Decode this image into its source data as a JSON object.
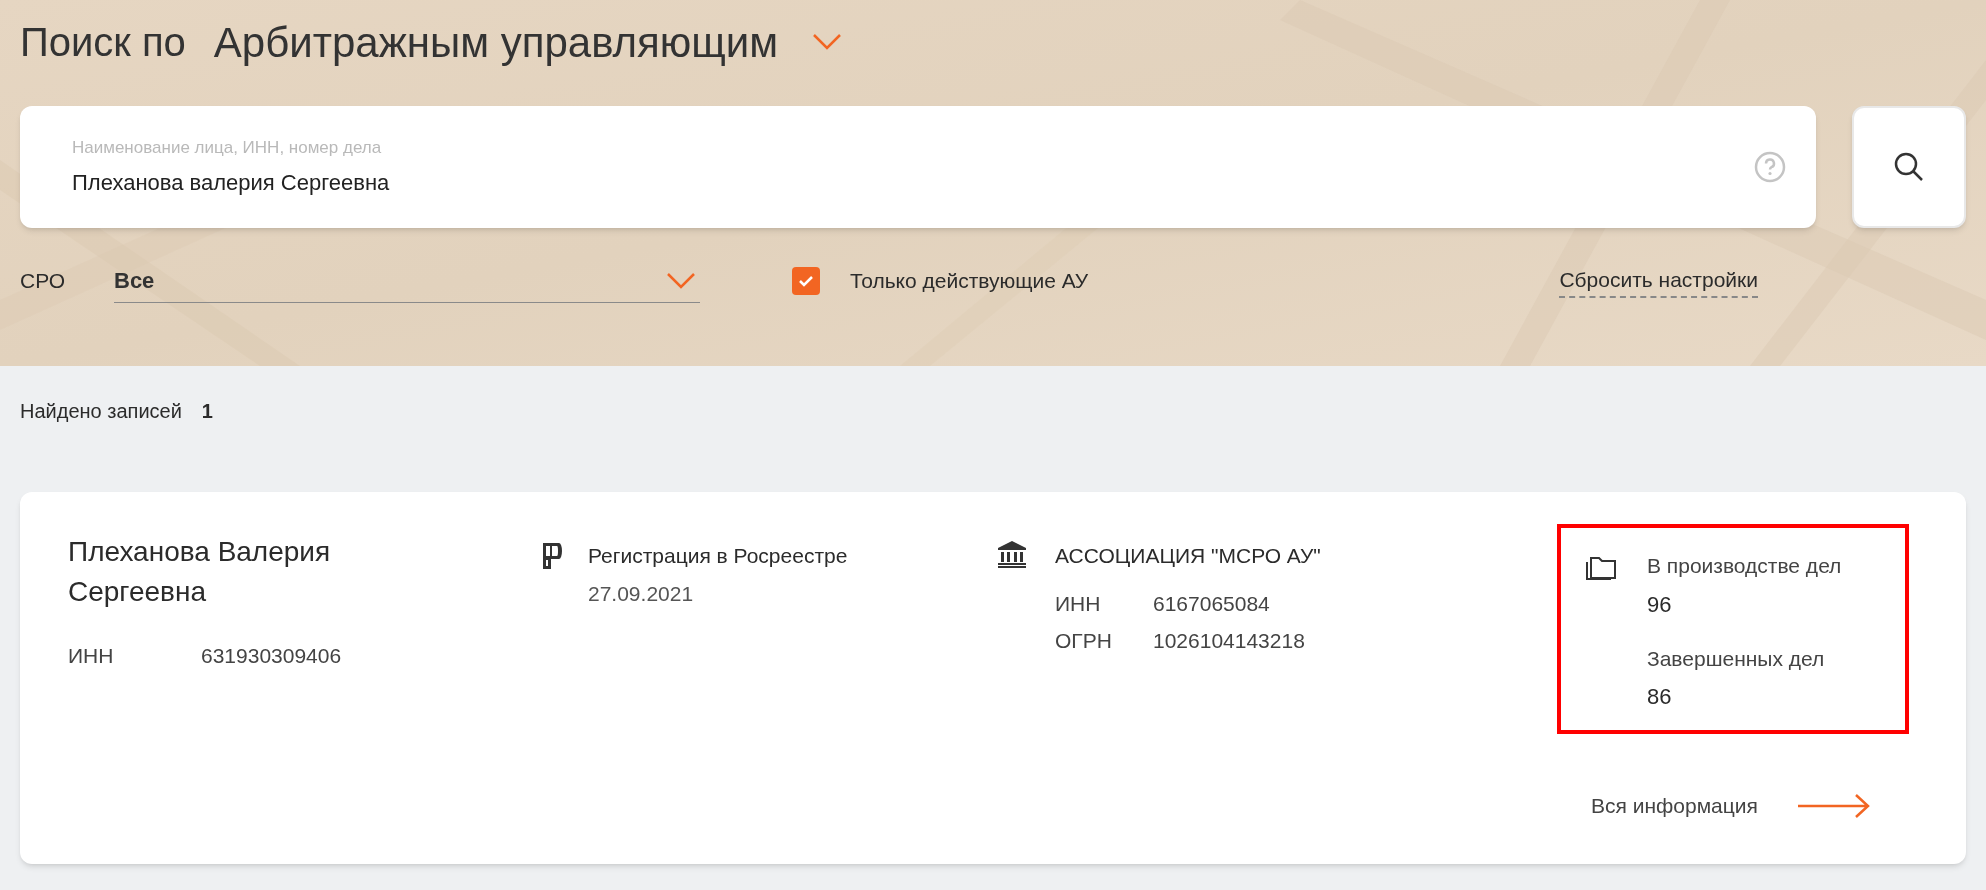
{
  "header": {
    "title_prefix": "Поиск по",
    "title_scope": "Арбитражным управляющим"
  },
  "search": {
    "placeholder": "Наименование лица, ИНН, номер дела",
    "value": "Плеханова валерия Сергеевна"
  },
  "filters": {
    "sro_label": "СРО",
    "sro_value": "Все",
    "active_only": {
      "label": "Только действующие АУ",
      "checked": true
    },
    "reset": "Сбросить настройки"
  },
  "results": {
    "found_label": "Найдено записей",
    "found_count": "1"
  },
  "cards": [
    {
      "name": "Плеханова Валерия Сергеевна",
      "inn_label": "ИНН",
      "inn": "631930309406",
      "registration": {
        "title": "Регистрация в Росреестре",
        "date": "27.09.2021"
      },
      "sro": {
        "name": "АССОЦИАЦИЯ \"МСРО АУ\"",
        "fields": [
          {
            "label": "ИНН",
            "value": "6167065084"
          },
          {
            "label": "ОГРН",
            "value": "1026104143218"
          }
        ]
      },
      "stats": {
        "highlighted": true,
        "items": [
          {
            "label": "В производстве дел",
            "value": "96"
          },
          {
            "label": "Завершенных дел",
            "value": "86"
          }
        ]
      },
      "more": "Вся информация"
    }
  ]
}
